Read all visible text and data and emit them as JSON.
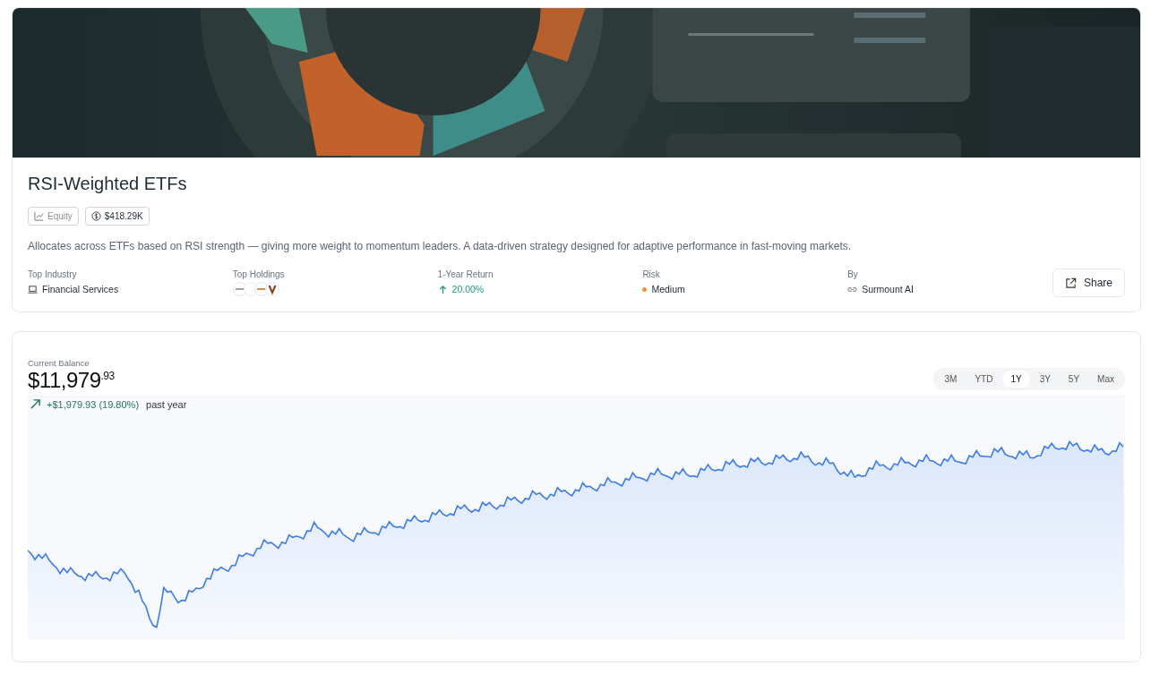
{
  "strategy": {
    "title": "RSI-Weighted ETFs",
    "tags": [
      {
        "kind": "category",
        "label": "Equity"
      },
      {
        "kind": "money",
        "label": "$418.29K"
      }
    ],
    "description": "Allocates across ETFs based on RSI strength — giving more weight to momentum leaders. A data-driven strategy designed for adaptive performance in fast-moving markets.",
    "stats": [
      {
        "kind": "industry",
        "label": "Top Industry",
        "value": "Financial Services"
      },
      {
        "kind": "holdings",
        "label": "Top Holdings"
      },
      {
        "kind": "return",
        "label": "1-Year Return",
        "value": "20.00%"
      },
      {
        "kind": "risk",
        "label": "Risk",
        "value": "Medium",
        "color": "#f0923a"
      },
      {
        "kind": "author",
        "label": "By",
        "value": "Surmount AI"
      }
    ],
    "share_button": "Share"
  },
  "balance": {
    "label": "Current Balance",
    "whole": "$11,979",
    "cents": ".93",
    "change": "+$1,979.93 (19.80%)",
    "period": "past year",
    "ranges": [
      {
        "label": "3M",
        "selected": false
      },
      {
        "label": "YTD",
        "selected": false
      },
      {
        "label": "1Y",
        "selected": true
      },
      {
        "label": "3Y",
        "selected": false
      },
      {
        "label": "5Y",
        "selected": false
      },
      {
        "label": "Max",
        "selected": false
      }
    ]
  }
}
